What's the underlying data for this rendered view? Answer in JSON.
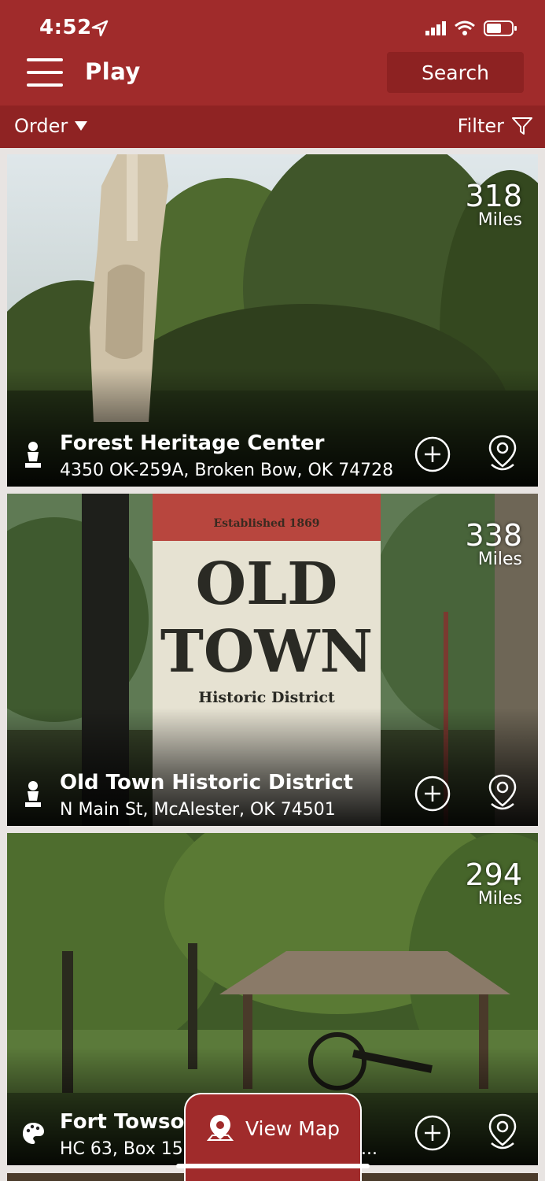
{
  "status": {
    "time": "4:52"
  },
  "header": {
    "title": "Play",
    "search_label": "Search"
  },
  "toolbar": {
    "order_label": "Order",
    "filter_label": "Filter"
  },
  "places": [
    {
      "title": "Forest Heritage Center",
      "address": "4350 OK-259A, Broken Bow, OK 74728",
      "distance": "318",
      "unit": "Miles",
      "category_icon": "person-statue-icon"
    },
    {
      "title": "Old Town Historic District",
      "address": "N Main St, McAlester, OK 74501",
      "distance": "338",
      "unit": "Miles",
      "category_icon": "person-statue-icon",
      "sign_top": "Established 1869",
      "sign_line1": "OLD",
      "sign_line2": "TOWN",
      "sign_line3": "Historic District"
    },
    {
      "title": "Fort Towson",
      "address": "HC 63, Box 158",
      "distance": "294",
      "unit": "Miles",
      "category_icon": "art-palette-icon",
      "truncation": "..."
    }
  ],
  "footer": {
    "view_map_label": "View Map"
  },
  "colors": {
    "brand": "#a02b2b",
    "brand_dark": "#8f2323"
  }
}
